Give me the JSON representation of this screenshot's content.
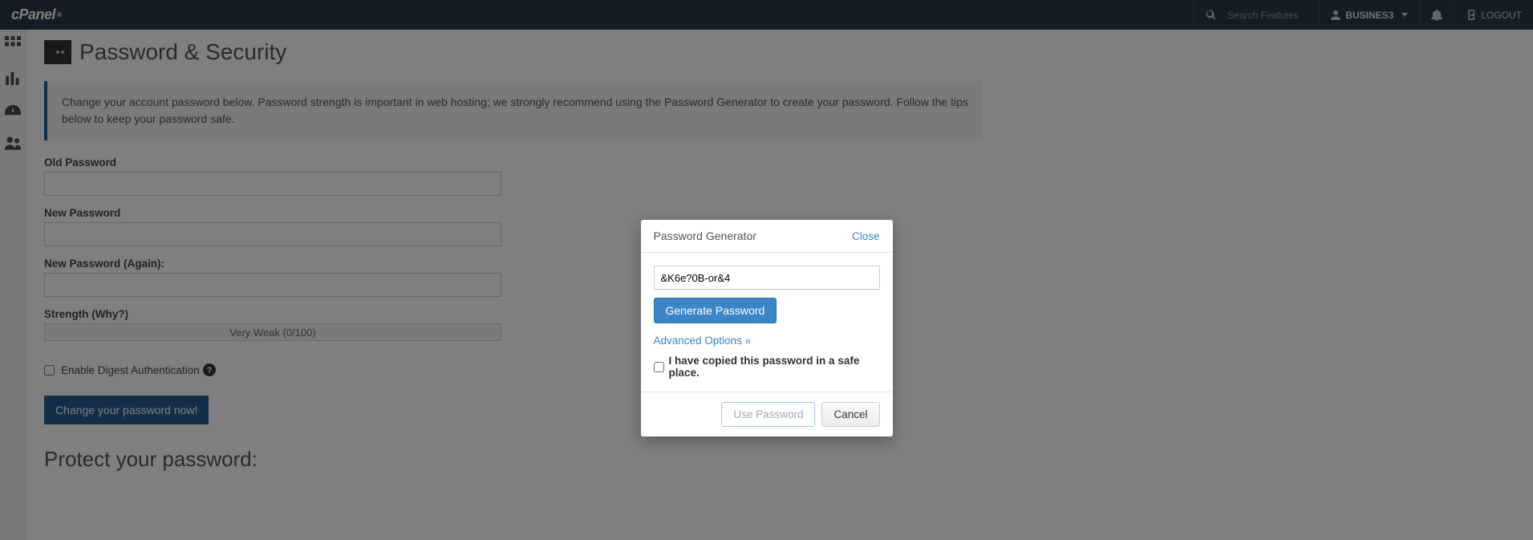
{
  "brand": "cPanel",
  "topbar": {
    "search_placeholder": "Search Features",
    "username": "BUSINES3",
    "logout": "LOGOUT"
  },
  "page": {
    "title": "Password & Security",
    "info_text": "Change your account password below. Password strength is important in web hosting; we strongly recommend using the Password Generator to create your password. Follow the tips below to keep your password safe.",
    "old_password_label": "Old Password",
    "new_password_label": "New Password",
    "new_password_again_label": "New Password (Again):",
    "strength_label": "Strength (Why?)",
    "strength_value": "Very Weak (0/100)",
    "digest_label": "Enable Digest Authentication",
    "submit_label": "Change your password now!",
    "protect_heading": "Protect your password:"
  },
  "modal": {
    "title": "Password Generator",
    "close": "Close",
    "generated_password": "&K6e?0B-or&4",
    "generate_btn": "Generate Password",
    "advanced_link": "Advanced Options »",
    "copied_label": "I have copied this password in a safe place.",
    "use_btn": "Use Password",
    "cancel_btn": "Cancel"
  }
}
